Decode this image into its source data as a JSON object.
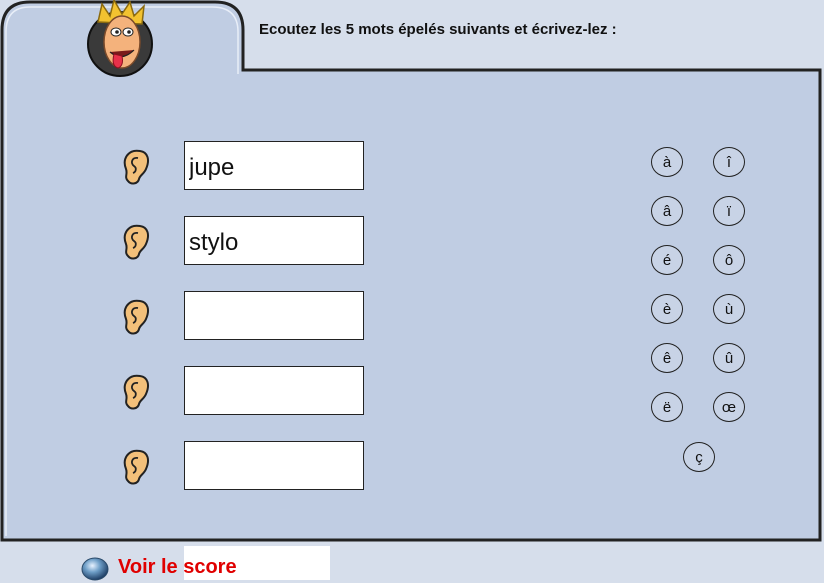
{
  "instruction": "Ecoutez les 5 mots épelés suivants et écrivez-lez :",
  "mascot_icon": "cartoon-face-tongue-out",
  "ear_icon": "ear-icon",
  "words": [
    {
      "value": "jupe"
    },
    {
      "value": "stylo"
    },
    {
      "value": ""
    },
    {
      "value": ""
    },
    {
      "value": ""
    }
  ],
  "accents": {
    "left": [
      "à",
      "â",
      "é",
      "è",
      "ê",
      "ë"
    ],
    "right": [
      "î",
      "ï",
      "ô",
      "ù",
      "û",
      "œ"
    ],
    "bottom": "ç"
  },
  "score_label": "Voir le score",
  "colors": {
    "background": "#d6deeb",
    "panel": "#c0cde3",
    "border": "#222222",
    "score_text": "#e00000"
  }
}
